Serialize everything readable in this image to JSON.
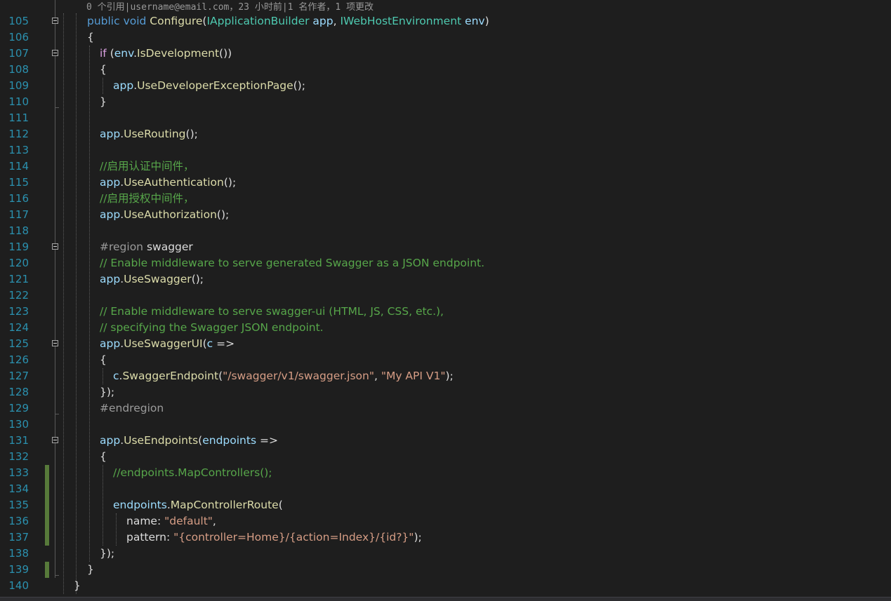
{
  "editor": {
    "codelens": "0 个引用|username@email.com，23 小时前|1 名作者，1 项更改",
    "lines": [
      {
        "n": "105",
        "indent": 1,
        "fold": true,
        "tokens": [
          [
            "k",
            "public void "
          ],
          [
            "m",
            "Configure"
          ],
          [
            "p",
            "("
          ],
          [
            "t",
            "IApplicationBuilder"
          ],
          [
            "p",
            " "
          ],
          [
            "v",
            "app"
          ],
          [
            "p",
            ", "
          ],
          [
            "t",
            "IWebHostEnvironment"
          ],
          [
            "p",
            " "
          ],
          [
            "v",
            "env"
          ],
          [
            "p",
            ")"
          ]
        ]
      },
      {
        "n": "106",
        "indent": 1,
        "tokens": [
          [
            "p",
            "{"
          ]
        ]
      },
      {
        "n": "107",
        "indent": 2,
        "fold": true,
        "tokens": [
          [
            "ctl",
            "if"
          ],
          [
            "p",
            " ("
          ],
          [
            "v",
            "env"
          ],
          [
            "p",
            "."
          ],
          [
            "m",
            "IsDevelopment"
          ],
          [
            "p",
            "())"
          ]
        ]
      },
      {
        "n": "108",
        "indent": 2,
        "tokens": [
          [
            "p",
            "{"
          ]
        ]
      },
      {
        "n": "109",
        "indent": 3,
        "tokens": [
          [
            "v",
            "app"
          ],
          [
            "p",
            "."
          ],
          [
            "m",
            "UseDeveloperExceptionPage"
          ],
          [
            "p",
            "();"
          ]
        ]
      },
      {
        "n": "110",
        "indent": 2,
        "tokens": [
          [
            "p",
            "}"
          ]
        ]
      },
      {
        "n": "111",
        "indent": 2,
        "tokens": []
      },
      {
        "n": "112",
        "indent": 2,
        "tokens": [
          [
            "v",
            "app"
          ],
          [
            "p",
            "."
          ],
          [
            "m",
            "UseRouting"
          ],
          [
            "p",
            "();"
          ]
        ]
      },
      {
        "n": "113",
        "indent": 2,
        "tokens": []
      },
      {
        "n": "114",
        "indent": 2,
        "tokens": [
          [
            "c",
            "//启用认证中间件，"
          ]
        ]
      },
      {
        "n": "115",
        "indent": 2,
        "tokens": [
          [
            "v",
            "app"
          ],
          [
            "p",
            "."
          ],
          [
            "m",
            "UseAuthentication"
          ],
          [
            "p",
            "();"
          ]
        ]
      },
      {
        "n": "116",
        "indent": 2,
        "tokens": [
          [
            "c",
            "//启用授权中间件，"
          ]
        ]
      },
      {
        "n": "117",
        "indent": 2,
        "tokens": [
          [
            "v",
            "app"
          ],
          [
            "p",
            "."
          ],
          [
            "m",
            "UseAuthorization"
          ],
          [
            "p",
            "();"
          ]
        ]
      },
      {
        "n": "118",
        "indent": 2,
        "tokens": []
      },
      {
        "n": "119",
        "indent": 2,
        "fold": true,
        "tokens": [
          [
            "pp",
            "#region "
          ],
          [
            "p",
            "swagger"
          ]
        ]
      },
      {
        "n": "120",
        "indent": 2,
        "tokens": [
          [
            "c",
            "// Enable middleware to serve generated Swagger as a JSON endpoint."
          ]
        ]
      },
      {
        "n": "121",
        "indent": 2,
        "tokens": [
          [
            "v",
            "app"
          ],
          [
            "p",
            "."
          ],
          [
            "m",
            "UseSwagger"
          ],
          [
            "p",
            "();"
          ]
        ]
      },
      {
        "n": "122",
        "indent": 2,
        "tokens": []
      },
      {
        "n": "123",
        "indent": 2,
        "tokens": [
          [
            "c",
            "// Enable middleware to serve swagger-ui (HTML, JS, CSS, etc.),"
          ]
        ]
      },
      {
        "n": "124",
        "indent": 2,
        "tokens": [
          [
            "c",
            "// specifying the Swagger JSON endpoint."
          ]
        ]
      },
      {
        "n": "125",
        "indent": 2,
        "fold": true,
        "tokens": [
          [
            "v",
            "app"
          ],
          [
            "p",
            "."
          ],
          [
            "m",
            "UseSwaggerUI"
          ],
          [
            "p",
            "("
          ],
          [
            "v",
            "c"
          ],
          [
            "p",
            " =>"
          ]
        ]
      },
      {
        "n": "126",
        "indent": 2,
        "tokens": [
          [
            "p",
            "{"
          ]
        ]
      },
      {
        "n": "127",
        "indent": 3,
        "tokens": [
          [
            "v",
            "c"
          ],
          [
            "p",
            "."
          ],
          [
            "m",
            "SwaggerEndpoint"
          ],
          [
            "p",
            "("
          ],
          [
            "s",
            "\"/swagger/v1/swagger.json\""
          ],
          [
            "p",
            ", "
          ],
          [
            "s",
            "\"My API V1\""
          ],
          [
            "p",
            ");"
          ]
        ]
      },
      {
        "n": "128",
        "indent": 2,
        "tokens": [
          [
            "p",
            "});"
          ]
        ]
      },
      {
        "n": "129",
        "indent": 2,
        "tokens": [
          [
            "pp",
            "#endregion"
          ]
        ]
      },
      {
        "n": "130",
        "indent": 2,
        "tokens": []
      },
      {
        "n": "131",
        "indent": 2,
        "fold": true,
        "tokens": [
          [
            "v",
            "app"
          ],
          [
            "p",
            "."
          ],
          [
            "m",
            "UseEndpoints"
          ],
          [
            "p",
            "("
          ],
          [
            "v",
            "endpoints"
          ],
          [
            "p",
            " =>"
          ]
        ]
      },
      {
        "n": "132",
        "indent": 2,
        "tokens": [
          [
            "p",
            "{"
          ]
        ]
      },
      {
        "n": "133",
        "indent": 3,
        "changed": true,
        "tokens": [
          [
            "c",
            "//endpoints.MapControllers();"
          ]
        ]
      },
      {
        "n": "134",
        "indent": 3,
        "changed": true,
        "tokens": []
      },
      {
        "n": "135",
        "indent": 3,
        "changed": true,
        "tokens": [
          [
            "v",
            "endpoints"
          ],
          [
            "p",
            "."
          ],
          [
            "m",
            "MapControllerRoute"
          ],
          [
            "p",
            "("
          ]
        ]
      },
      {
        "n": "136",
        "indent": 4,
        "changed": true,
        "tokens": [
          [
            "pl",
            "name"
          ],
          [
            "p",
            ": "
          ],
          [
            "s",
            "\"default\""
          ],
          [
            "p",
            ","
          ]
        ]
      },
      {
        "n": "137",
        "indent": 4,
        "changed": true,
        "tokens": [
          [
            "pl",
            "pattern"
          ],
          [
            "p",
            ": "
          ],
          [
            "s",
            "\"{controller=Home}/{action=Index}/{id?}\""
          ],
          [
            "p",
            ");"
          ]
        ]
      },
      {
        "n": "138",
        "indent": 2,
        "tokens": [
          [
            "p",
            "});"
          ]
        ]
      },
      {
        "n": "139",
        "indent": 1,
        "changed": true,
        "tokens": [
          [
            "p",
            "}"
          ]
        ]
      },
      {
        "n": "140",
        "indent": 0,
        "tokens": [
          [
            "p",
            "}"
          ]
        ]
      }
    ]
  },
  "colors": {
    "background": "#1e1e1e",
    "line_number": "#2b91af",
    "keyword": "#569cd6",
    "control_keyword": "#d8a0df",
    "method": "#dcdcaa",
    "variable": "#9cdcfe",
    "type": "#4ec9b0",
    "comment": "#57a64a",
    "string": "#d69d85",
    "change_bar": "#577a3a"
  }
}
